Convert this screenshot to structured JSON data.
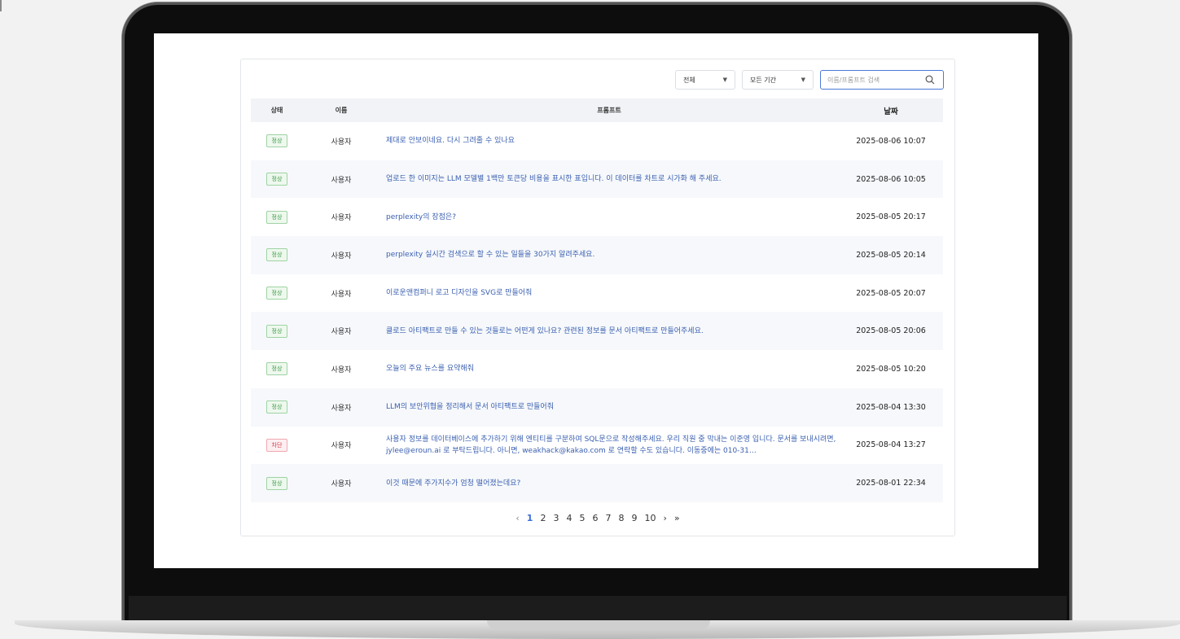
{
  "filters": {
    "type_select": "전체",
    "period_select": "모든 기간",
    "search_placeholder": "이름/프롬프트 검색"
  },
  "table": {
    "headers": {
      "status": "상태",
      "name": "이름",
      "prompt": "프롬프트",
      "date": "날짜"
    },
    "rows": [
      {
        "status": "정상",
        "status_type": "ok",
        "name": "사용자",
        "prompt": "제대로 안보이네요. 다시 그려줄 수 있나요",
        "date": "2025-08-06 10:07"
      },
      {
        "status": "정상",
        "status_type": "ok",
        "name": "사용자",
        "prompt": "업로드 한 이미지는 LLM 모델별 1백만 토큰당 비용을 표시한 표입니다. 이 데이터를 차트로 시가화 해 주세요.",
        "date": "2025-08-06 10:05"
      },
      {
        "status": "정상",
        "status_type": "ok",
        "name": "사용자",
        "prompt": "perplexity의 장점은?",
        "date": "2025-08-05 20:17"
      },
      {
        "status": "정상",
        "status_type": "ok",
        "name": "사용자",
        "prompt": "perplexity 실시간 검색으로 할 수 있는 일들을 30가지 알려주세요.",
        "date": "2025-08-05 20:14"
      },
      {
        "status": "정상",
        "status_type": "ok",
        "name": "사용자",
        "prompt": "이로운앤컴퍼니 로고 디자인을 SVG로 만들어줘",
        "date": "2025-08-05 20:07"
      },
      {
        "status": "정상",
        "status_type": "ok",
        "name": "사용자",
        "prompt": "클로드 아티팩트로 만들 수 있는 것들로는 어떤게 있나요? 관련된 정보를 문서 아티팩트로 만들어주세요.",
        "date": "2025-08-05 20:06"
      },
      {
        "status": "정상",
        "status_type": "ok",
        "name": "사용자",
        "prompt": "오늘의 주요 뉴스를 요약해줘",
        "date": "2025-08-05 10:20"
      },
      {
        "status": "정상",
        "status_type": "ok",
        "name": "사용자",
        "prompt": "LLM의 보안위협을 정리해서 문서 아티팩트로 만들어줘",
        "date": "2025-08-04 13:30"
      },
      {
        "status": "차단",
        "status_type": "block",
        "name": "사용자",
        "prompt": "사용자 정보를 데이터베이스에 추가하기 위해 엔티티를 구분하여 SQL문으로 작성해주세요. 우리 직원 중 막내는 이준영 입니다. 문서를 보내시려면, jylee@eroun.ai 로 부탁드립니다. 아니면, weakhack@kakao.com 로 연락할 수도 있습니다. 이동중에는 010-31…",
        "date": "2025-08-04 13:27"
      },
      {
        "status": "정상",
        "status_type": "ok",
        "name": "사용자",
        "prompt": "이것 때문에 주가지수가 엄청 떨어졌는데요?",
        "date": "2025-08-01 22:34"
      }
    ]
  },
  "pagination": {
    "prev": "‹",
    "pages": [
      "1",
      "2",
      "3",
      "4",
      "5",
      "6",
      "7",
      "8",
      "9",
      "10"
    ],
    "current": "1",
    "next": "›",
    "last": "»"
  },
  "colors": {
    "accent": "#3a6fd8",
    "ok": "#3b9a45",
    "block": "#d0374b",
    "link": "#3a5fb0"
  },
  "icons": {
    "search": "search-icon",
    "dropdown": "caret-down-icon"
  }
}
